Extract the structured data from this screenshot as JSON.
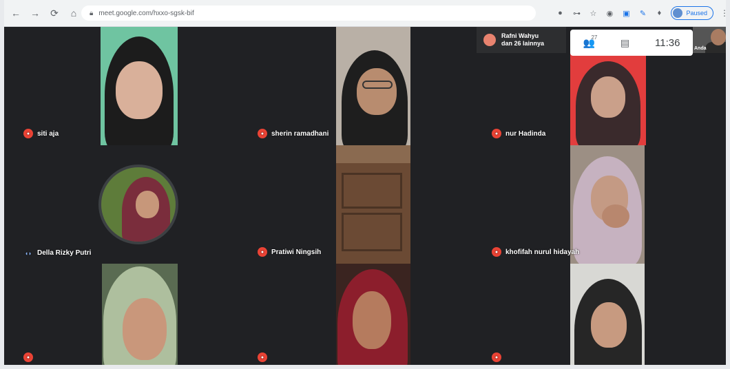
{
  "browser": {
    "url": "meet.google.com/hxxo-sgsk-bif",
    "profile_label": "Paused",
    "nav": {
      "back": "←",
      "forward": "→",
      "reload": "⟳",
      "home": "⌂"
    },
    "extensions": [
      "●",
      "⊶",
      "☆",
      "◉",
      "▣",
      "✎",
      "♦"
    ],
    "menu": "⋮"
  },
  "meet": {
    "joiner_notice": {
      "line1": "Rafni Wahyu",
      "line2": "dan 26 lainnya"
    },
    "people_icon": "👥",
    "people_count": "27",
    "chat_icon": "▤",
    "time": "11:36",
    "self_label": "Anda",
    "participants": [
      {
        "name": "siti aja",
        "muted": true
      },
      {
        "name": "sherin ramadhani",
        "muted": true
      },
      {
        "name": "nur Hadinda",
        "muted": true
      },
      {
        "name": "Della Rizky Putri",
        "muted": false
      },
      {
        "name": "Pratiwi Ningsih",
        "muted": true
      },
      {
        "name": "khofifah nurul hidayah",
        "muted": true
      },
      {
        "name": "",
        "muted": true
      },
      {
        "name": "",
        "muted": true
      },
      {
        "name": "",
        "muted": true
      }
    ],
    "mic_off_icon": "🎙",
    "speaking_icon": "◖◗"
  },
  "colors": {
    "accent": "#1a73e8",
    "mic_off": "#ea4335",
    "stage": "#202124"
  }
}
